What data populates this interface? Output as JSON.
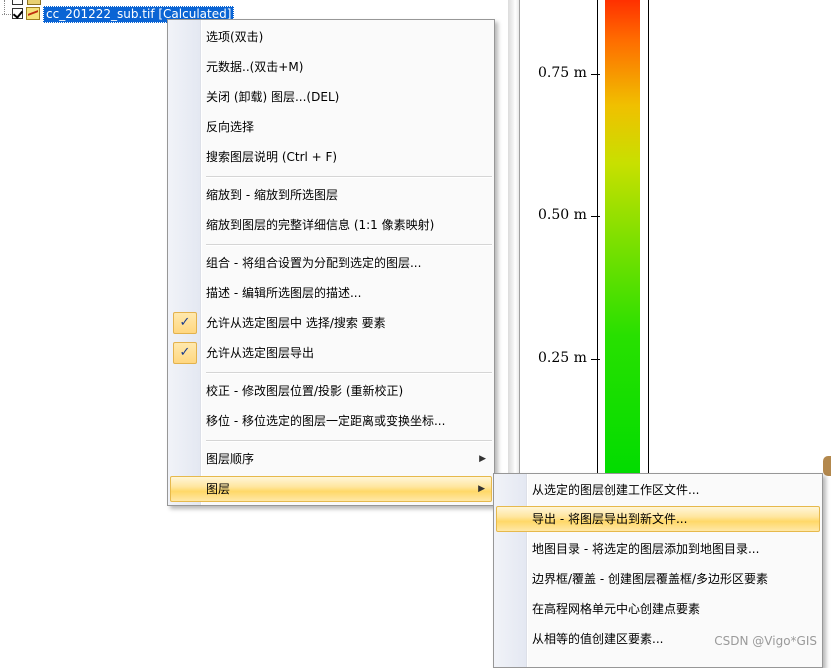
{
  "tree": {
    "layer_name": "cc_201222_sub.tif [Calculated]"
  },
  "legend": {
    "ticks": [
      {
        "label": "0.75 m",
        "value": 0.75
      },
      {
        "label": "0.50 m",
        "value": 0.5
      },
      {
        "label": "0.25 m",
        "value": 0.25
      }
    ]
  },
  "context_menu": {
    "items": [
      {
        "label": "选项(双击)"
      },
      {
        "label": "元数据..(双击+M)"
      },
      {
        "label": "关闭 (卸载) 图层...(DEL)"
      },
      {
        "label": "反向选择"
      },
      {
        "label": "搜索图层说明 (Ctrl + F)"
      },
      {
        "label": "缩放到 - 缩放到所选图层"
      },
      {
        "label": "缩放到图层的完整详细信息 (1:1 像素映射)"
      },
      {
        "label": "组合 - 将组合设置为分配到选定的图层..."
      },
      {
        "label": "描述 - 编辑所选图层的描述..."
      },
      {
        "label": "允许从选定图层中 选择/搜索 要素",
        "checked": true
      },
      {
        "label": "允许从选定图层导出",
        "checked": true
      },
      {
        "label": "校正 - 修改图层位置/投影 (重新校正)"
      },
      {
        "label": "移位 - 移位选定的图层一定距离或变换坐标..."
      },
      {
        "label": "图层顺序"
      },
      {
        "label": "图层"
      }
    ],
    "check_glyph": "✓",
    "arrow_glyph": "▶"
  },
  "submenu": {
    "items": [
      {
        "label": "从选定的图层创建工作区文件..."
      },
      {
        "label": "导出 - 将图层导出到新文件..."
      },
      {
        "label": "地图目录 - 将选定的图层添加到地图目录..."
      },
      {
        "label": "边界框/覆盖 - 创建图层覆盖框/多边形区要素"
      },
      {
        "label": "在高程网格单元中心创建点要素"
      },
      {
        "label": "从相等的值创建区要素..."
      }
    ]
  },
  "watermark": "CSDN @Vigo*GIS",
  "colors": {
    "selection_blue": "#0a64d4",
    "highlight_gold": "#ffd868",
    "legend_top": "#ff3000",
    "legend_bottom": "#00dc00"
  }
}
